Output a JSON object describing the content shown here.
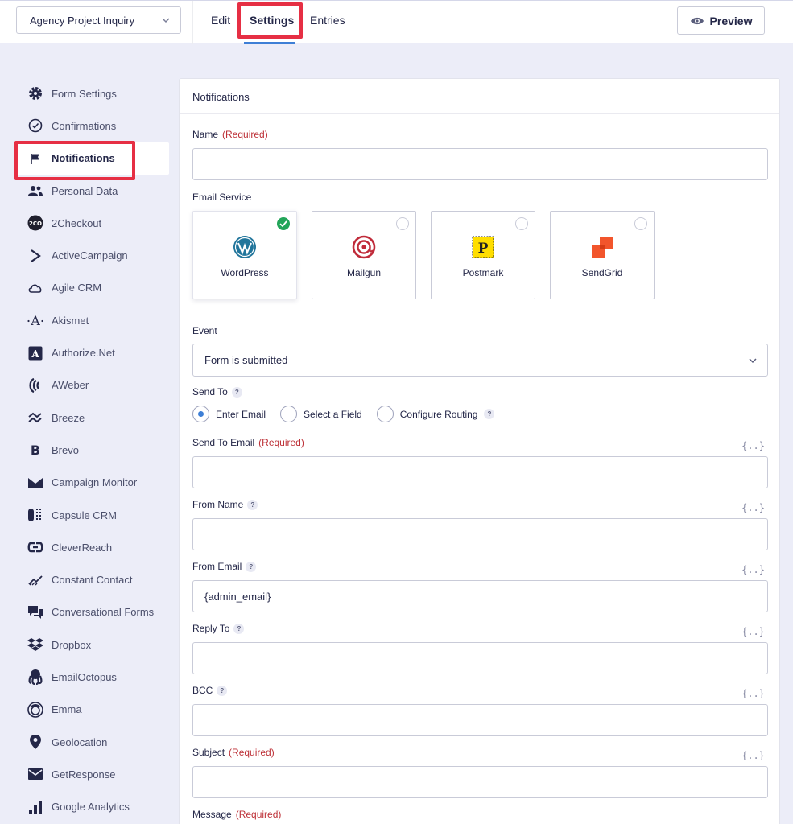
{
  "header": {
    "form_select": "Agency Project Inquiry",
    "tabs": [
      {
        "label": "Edit"
      },
      {
        "label": "Settings"
      },
      {
        "label": "Entries"
      }
    ],
    "preview_label": "Preview"
  },
  "sidebar": {
    "items": [
      {
        "label": "Form Settings",
        "icon": "gear-icon"
      },
      {
        "label": "Confirmations",
        "icon": "check-circle-icon"
      },
      {
        "label": "Notifications",
        "icon": "flag-icon"
      },
      {
        "label": "Personal Data",
        "icon": "users-icon"
      },
      {
        "label": "2Checkout",
        "icon": "2checkout-icon"
      },
      {
        "label": "ActiveCampaign",
        "icon": "activecampaign-icon"
      },
      {
        "label": "Agile CRM",
        "icon": "cloud-icon"
      },
      {
        "label": "Akismet",
        "icon": "akismet-icon"
      },
      {
        "label": "Authorize.Net",
        "icon": "authorize-net-icon"
      },
      {
        "label": "AWeber",
        "icon": "aweber-icon"
      },
      {
        "label": "Breeze",
        "icon": "breeze-icon"
      },
      {
        "label": "Brevo",
        "icon": "brevo-icon"
      },
      {
        "label": "Campaign Monitor",
        "icon": "campaign-monitor-icon"
      },
      {
        "label": "Capsule CRM",
        "icon": "capsule-icon"
      },
      {
        "label": "CleverReach",
        "icon": "cleverreach-icon"
      },
      {
        "label": "Constant Contact",
        "icon": "constant-contact-icon"
      },
      {
        "label": "Conversational Forms",
        "icon": "chat-icon"
      },
      {
        "label": "Dropbox",
        "icon": "dropbox-icon"
      },
      {
        "label": "EmailOctopus",
        "icon": "octopus-icon"
      },
      {
        "label": "Emma",
        "icon": "emma-icon"
      },
      {
        "label": "Geolocation",
        "icon": "map-pin-icon"
      },
      {
        "label": "GetResponse",
        "icon": "envelope-icon"
      },
      {
        "label": "Google Analytics",
        "icon": "bar-chart-icon"
      }
    ]
  },
  "panel": {
    "title": "Notifications",
    "name_label": "Name",
    "required_tag": "(Required)",
    "name_value": "",
    "email_service_label": "Email Service",
    "services": [
      {
        "label": "WordPress",
        "selected": true
      },
      {
        "label": "Mailgun",
        "selected": false
      },
      {
        "label": "Postmark",
        "selected": false
      },
      {
        "label": "SendGrid",
        "selected": false
      }
    ],
    "event_label": "Event",
    "event_value": "Form is submitted",
    "send_to_label": "Send To",
    "send_to_options": [
      {
        "label": "Enter Email",
        "checked": true
      },
      {
        "label": "Select a Field",
        "checked": false
      },
      {
        "label": "Configure Routing",
        "checked": false
      }
    ],
    "merge_tag_glyph": "{..}",
    "send_to_email_label": "Send To Email",
    "send_to_email_value": "",
    "from_name_label": "From Name",
    "from_name_value": "",
    "from_email_label": "From Email",
    "from_email_value": "{admin_email}",
    "reply_to_label": "Reply To",
    "reply_to_value": "",
    "bcc_label": "BCC",
    "bcc_value": "",
    "subject_label": "Subject",
    "subject_value": "",
    "message_label": "Message",
    "help_glyph": "?"
  },
  "colors": {
    "accent_blue": "#3e7fd6",
    "required_red": "#bd3037",
    "highlight_red": "#e62f44",
    "success_green": "#23a559"
  }
}
